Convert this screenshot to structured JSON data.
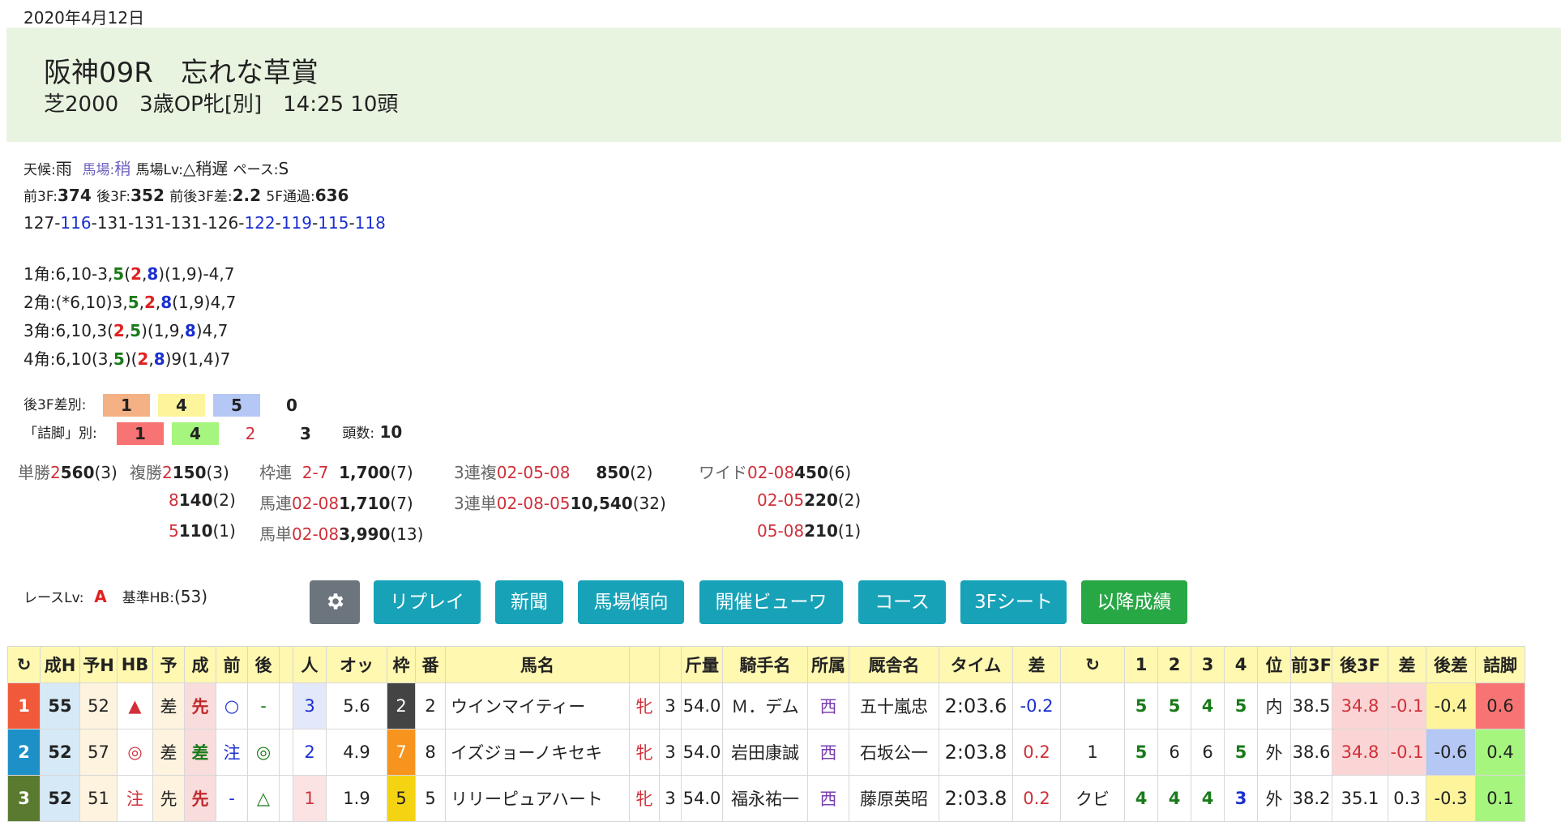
{
  "date": "2020年4月12日",
  "race": {
    "title": "阪神09R　忘れな草賞",
    "subtitle": "芝2000　3歳OP牝[別]　14:25 10頭"
  },
  "conditions": {
    "weather_label": "天候:",
    "weather": "雨",
    "track_label": "馬場:",
    "track": "稍",
    "track_lv_label": "馬場Lv:",
    "track_lv": "△稍遅",
    "pace_label": "ペース:",
    "pace": "S"
  },
  "splits": {
    "f3_label": "前3F:",
    "f3": "374",
    "l3_label": "後3F:",
    "l3": "352",
    "diff_label": "前後3F差:",
    "diff": "2.2",
    "pass_label": "5F通過:",
    "pass": "636"
  },
  "laps": [
    {
      "v": "127",
      "c": "#222222"
    },
    {
      "v": "116",
      "c": "#1a2fd0"
    },
    {
      "v": "131",
      "c": "#222222"
    },
    {
      "v": "131",
      "c": "#222222"
    },
    {
      "v": "131",
      "c": "#222222"
    },
    {
      "v": "126",
      "c": "#222222"
    },
    {
      "v": "122",
      "c": "#1a2fd0"
    },
    {
      "v": "119",
      "c": "#1a2fd0"
    },
    {
      "v": "115",
      "c": "#1a2fd0"
    },
    {
      "v": "118",
      "c": "#1a2fd0"
    }
  ],
  "corners": [
    [
      {
        "t": "1角:6,10-3,"
      },
      {
        "t": "5",
        "c": "green"
      },
      {
        "t": "("
      },
      {
        "t": "2",
        "c": "red"
      },
      {
        "t": ","
      },
      {
        "t": "8",
        "c": "blue"
      },
      {
        "t": ")(1,9)-4,7"
      }
    ],
    [
      {
        "t": "2角:(*6,10)3,"
      },
      {
        "t": "5",
        "c": "green"
      },
      {
        "t": ","
      },
      {
        "t": "2",
        "c": "red"
      },
      {
        "t": ","
      },
      {
        "t": "8",
        "c": "blue"
      },
      {
        "t": "(1,9)4,7"
      }
    ],
    [
      {
        "t": "3角:6,10,3("
      },
      {
        "t": "2",
        "c": "red"
      },
      {
        "t": ","
      },
      {
        "t": "5",
        "c": "green"
      },
      {
        "t": ")(1,9,"
      },
      {
        "t": "8",
        "c": "blue"
      },
      {
        "t": ")4,7"
      }
    ],
    [
      {
        "t": "4角:6,10(3,"
      },
      {
        "t": "5",
        "c": "green"
      },
      {
        "t": ")("
      },
      {
        "t": "2",
        "c": "red"
      },
      {
        "t": ","
      },
      {
        "t": "8",
        "c": "blue"
      },
      {
        "t": ")9(1,4)7"
      }
    ]
  ],
  "l3f_rank": {
    "label": "後3F差別:",
    "values": [
      "1",
      "4",
      "5",
      "0"
    ],
    "colors": [
      "#f4b183",
      "#fdf49c",
      "#b4c7f5",
      "#ffffff"
    ]
  },
  "tsume_rank": {
    "label": "「詰脚」別:",
    "values": [
      "1",
      "4",
      "2",
      "3"
    ],
    "colors": [
      "#f87474",
      "#a6f57e",
      "#ffffff",
      "#ffffff"
    ],
    "heads_label": "頭数:",
    "heads": "10"
  },
  "payouts": {
    "tansho_label": "単勝",
    "tansho": {
      "n": "2",
      "p": "560",
      "r": "(3)"
    },
    "fukusho_label": "複勝",
    "fukusho": [
      {
        "n": "2",
        "p": "150",
        "r": "(3)"
      },
      {
        "n": "8",
        "p": "140",
        "r": "(2)"
      },
      {
        "n": "5",
        "p": "110",
        "r": "(1)"
      }
    ],
    "wakuren_label": "枠連",
    "wakuren": {
      "n": "2-7",
      "p": "1,700",
      "r": "(7)"
    },
    "umaren_label": "馬連",
    "umaren": {
      "n": "02-08",
      "p": "1,710",
      "r": "(7)"
    },
    "umatan_label": "馬単",
    "umatan": {
      "n": "02-08",
      "p": "3,990",
      "r": "(13)"
    },
    "sanrenpuku_label": "3連複",
    "sanrenpuku": {
      "n": "02-05-08",
      "p": "850",
      "r": "(2)"
    },
    "sanrentan_label": "3連単",
    "sanrentan": {
      "n": "02-08-05",
      "p": "10,540",
      "r": "(32)"
    },
    "wide_label": "ワイド",
    "wide": [
      {
        "n": "02-08",
        "p": "450",
        "r": "(6)"
      },
      {
        "n": "02-05",
        "p": "220",
        "r": "(2)"
      },
      {
        "n": "05-08",
        "p": "210",
        "r": "(1)"
      }
    ]
  },
  "race_lv_label": "レースLv:",
  "race_lv": "A",
  "base_hb_label": "基準HB:",
  "base_hb": "(53)",
  "buttons": [
    "リプレイ",
    "新聞",
    "馬場傾向",
    "開催ビューワ",
    "コース",
    "3Fシート",
    "以降成績"
  ],
  "table": {
    "headers": [
      "↻",
      "成H",
      "予H",
      "HB",
      "予",
      "成",
      "前",
      "後",
      "",
      "人",
      "オッ",
      "枠",
      "番",
      "馬名",
      "",
      "",
      "斤量",
      "騎手名",
      "所属",
      "厩舎名",
      "タイム",
      "差",
      "↻",
      "1",
      "2",
      "3",
      "4",
      "位",
      "前3F",
      "後3F",
      "差",
      "後差",
      "詰脚"
    ],
    "rows": [
      [
        "1",
        "55",
        "52",
        "▲",
        "差",
        "先",
        "○",
        "-",
        "",
        "3",
        "5.6",
        "2",
        "2",
        "ウインマイティー",
        "牝",
        "3",
        "54.0",
        "Ｍ．デム",
        "西",
        "五十嵐忠",
        "2:03.6",
        "-0.2",
        "",
        "5",
        "5",
        "4",
        "5",
        "内",
        "38.5",
        "34.8",
        "-0.1",
        "-0.4",
        "0.6"
      ],
      [
        "2",
        "52",
        "57",
        "◎",
        "差",
        "差",
        "注",
        "◎",
        "",
        "2",
        "4.9",
        "7",
        "8",
        "イズジョーノキセキ",
        "牝",
        "3",
        "54.0",
        "岩田康誠",
        "西",
        "石坂公一",
        "2:03.8",
        "0.2",
        "1",
        "5",
        "6",
        "6",
        "5",
        "外",
        "38.6",
        "34.8",
        "-0.1",
        "-0.6",
        "0.4"
      ],
      [
        "3",
        "52",
        "51",
        "注",
        "先",
        "先",
        "-",
        "△",
        "",
        "1",
        "1.9",
        "5",
        "5",
        "リリーピュアハート",
        "牝",
        "3",
        "54.0",
        "福永祐一",
        "西",
        "藤原英昭",
        "2:03.8",
        "0.2",
        "クビ",
        "4",
        "4",
        "4",
        "3",
        "外",
        "38.2",
        "35.1",
        "0.3",
        "-0.3",
        "0.1"
      ]
    ]
  }
}
